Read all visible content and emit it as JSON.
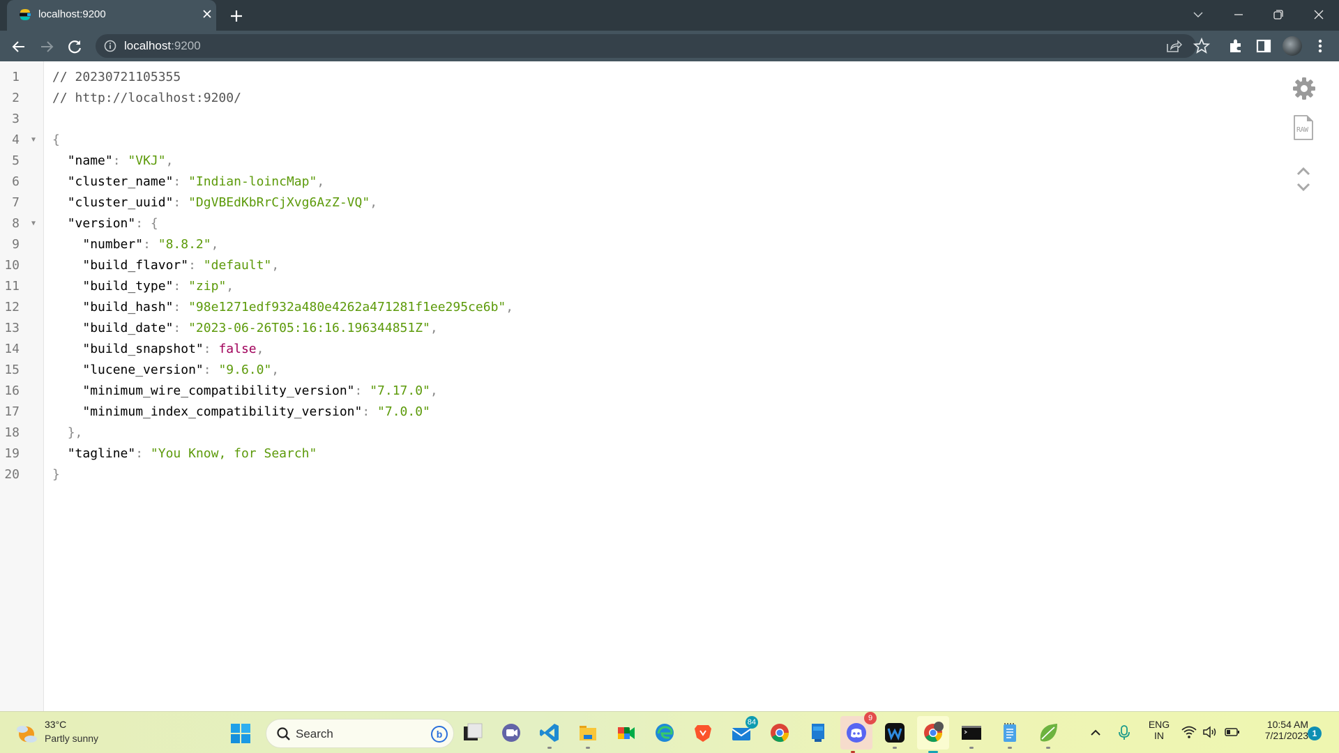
{
  "browser": {
    "tab": {
      "title": "localhost:9200",
      "favicon": "elasticsearch-logo-icon"
    },
    "new_tab_label": "+",
    "address_bar": {
      "host": "localhost",
      "port": ":9200"
    },
    "toolbar_icons": [
      "back-icon",
      "forward-icon",
      "reload-icon",
      "info-icon",
      "share-icon",
      "bookmark-star-icon",
      "extensions-puzzle-icon",
      "side-panel-icon",
      "profile-avatar",
      "menu-kebab-icon"
    ],
    "window_controls": [
      "tab-search-chevron-icon",
      "minimize-icon",
      "restore-icon",
      "close-icon"
    ]
  },
  "viewer": {
    "lines": [
      {
        "n": "1",
        "fold": false,
        "tokens": [
          {
            "t": "comment",
            "v": "// 20230721105355"
          }
        ]
      },
      {
        "n": "2",
        "fold": false,
        "tokens": [
          {
            "t": "comment",
            "v": "// http://localhost:9200/"
          }
        ]
      },
      {
        "n": "3",
        "fold": false,
        "tokens": []
      },
      {
        "n": "4",
        "fold": true,
        "tokens": [
          {
            "t": "punct",
            "v": "{"
          }
        ]
      },
      {
        "n": "5",
        "fold": false,
        "tokens": [
          {
            "t": "indent",
            "v": "  "
          },
          {
            "t": "key",
            "v": "\"name\""
          },
          {
            "t": "punct",
            "v": ": "
          },
          {
            "t": "str",
            "v": "\"VKJ\""
          },
          {
            "t": "punct",
            "v": ","
          }
        ]
      },
      {
        "n": "6",
        "fold": false,
        "tokens": [
          {
            "t": "indent",
            "v": "  "
          },
          {
            "t": "key",
            "v": "\"cluster_name\""
          },
          {
            "t": "punct",
            "v": ": "
          },
          {
            "t": "str",
            "v": "\"Indian-loincMap\""
          },
          {
            "t": "punct",
            "v": ","
          }
        ]
      },
      {
        "n": "7",
        "fold": false,
        "tokens": [
          {
            "t": "indent",
            "v": "  "
          },
          {
            "t": "key",
            "v": "\"cluster_uuid\""
          },
          {
            "t": "punct",
            "v": ": "
          },
          {
            "t": "str",
            "v": "\"DgVBEdKbRrCjXvg6AzZ-VQ\""
          },
          {
            "t": "punct",
            "v": ","
          }
        ]
      },
      {
        "n": "8",
        "fold": true,
        "tokens": [
          {
            "t": "indent",
            "v": "  "
          },
          {
            "t": "key",
            "v": "\"version\""
          },
          {
            "t": "punct",
            "v": ": {"
          }
        ]
      },
      {
        "n": "9",
        "fold": false,
        "tokens": [
          {
            "t": "indent",
            "v": "    "
          },
          {
            "t": "key",
            "v": "\"number\""
          },
          {
            "t": "punct",
            "v": ": "
          },
          {
            "t": "str",
            "v": "\"8.8.2\""
          },
          {
            "t": "punct",
            "v": ","
          }
        ]
      },
      {
        "n": "10",
        "fold": false,
        "tokens": [
          {
            "t": "indent",
            "v": "    "
          },
          {
            "t": "key",
            "v": "\"build_flavor\""
          },
          {
            "t": "punct",
            "v": ": "
          },
          {
            "t": "str",
            "v": "\"default\""
          },
          {
            "t": "punct",
            "v": ","
          }
        ]
      },
      {
        "n": "11",
        "fold": false,
        "tokens": [
          {
            "t": "indent",
            "v": "    "
          },
          {
            "t": "key",
            "v": "\"build_type\""
          },
          {
            "t": "punct",
            "v": ": "
          },
          {
            "t": "str",
            "v": "\"zip\""
          },
          {
            "t": "punct",
            "v": ","
          }
        ]
      },
      {
        "n": "12",
        "fold": false,
        "tokens": [
          {
            "t": "indent",
            "v": "    "
          },
          {
            "t": "key",
            "v": "\"build_hash\""
          },
          {
            "t": "punct",
            "v": ": "
          },
          {
            "t": "str",
            "v": "\"98e1271edf932a480e4262a471281f1ee295ce6b\""
          },
          {
            "t": "punct",
            "v": ","
          }
        ]
      },
      {
        "n": "13",
        "fold": false,
        "tokens": [
          {
            "t": "indent",
            "v": "    "
          },
          {
            "t": "key",
            "v": "\"build_date\""
          },
          {
            "t": "punct",
            "v": ": "
          },
          {
            "t": "str",
            "v": "\"2023-06-26T05:16:16.196344851Z\""
          },
          {
            "t": "punct",
            "v": ","
          }
        ]
      },
      {
        "n": "14",
        "fold": false,
        "tokens": [
          {
            "t": "indent",
            "v": "    "
          },
          {
            "t": "key",
            "v": "\"build_snapshot\""
          },
          {
            "t": "punct",
            "v": ": "
          },
          {
            "t": "bool",
            "v": "false"
          },
          {
            "t": "punct",
            "v": ","
          }
        ]
      },
      {
        "n": "15",
        "fold": false,
        "tokens": [
          {
            "t": "indent",
            "v": "    "
          },
          {
            "t": "key",
            "v": "\"lucene_version\""
          },
          {
            "t": "punct",
            "v": ": "
          },
          {
            "t": "str",
            "v": "\"9.6.0\""
          },
          {
            "t": "punct",
            "v": ","
          }
        ]
      },
      {
        "n": "16",
        "fold": false,
        "tokens": [
          {
            "t": "indent",
            "v": "    "
          },
          {
            "t": "key",
            "v": "\"minimum_wire_compatibility_version\""
          },
          {
            "t": "punct",
            "v": ": "
          },
          {
            "t": "str",
            "v": "\"7.17.0\""
          },
          {
            "t": "punct",
            "v": ","
          }
        ]
      },
      {
        "n": "17",
        "fold": false,
        "tokens": [
          {
            "t": "indent",
            "v": "    "
          },
          {
            "t": "key",
            "v": "\"minimum_index_compatibility_version\""
          },
          {
            "t": "punct",
            "v": ": "
          },
          {
            "t": "str",
            "v": "\"7.0.0\""
          }
        ]
      },
      {
        "n": "18",
        "fold": false,
        "tokens": [
          {
            "t": "indent",
            "v": "  "
          },
          {
            "t": "punct",
            "v": "},"
          }
        ]
      },
      {
        "n": "19",
        "fold": false,
        "tokens": [
          {
            "t": "indent",
            "v": "  "
          },
          {
            "t": "key",
            "v": "\"tagline\""
          },
          {
            "t": "punct",
            "v": ": "
          },
          {
            "t": "str",
            "v": "\"You Know, for Search\""
          }
        ]
      },
      {
        "n": "20",
        "fold": false,
        "tokens": [
          {
            "t": "punct",
            "v": "}"
          }
        ]
      }
    ],
    "side_tools": {
      "settings": "gear-icon",
      "raw_label": "RAW",
      "scroll_up": "chevron-up-icon",
      "scroll_down": "chevron-down-icon"
    }
  },
  "taskbar": {
    "weather": {
      "temp": "33°C",
      "desc": "Partly sunny"
    },
    "search_label": "Search",
    "bing_label": "b",
    "apps": [
      {
        "name": "task-view",
        "badge": null
      },
      {
        "name": "teams-meet",
        "badge": null
      },
      {
        "name": "vscode",
        "badge": null
      },
      {
        "name": "file-explorer",
        "badge": null
      },
      {
        "name": "google-meet",
        "badge": null
      },
      {
        "name": "edge",
        "badge": null
      },
      {
        "name": "brave",
        "badge": null
      },
      {
        "name": "mail",
        "badge": "84"
      },
      {
        "name": "chrome",
        "badge": null
      },
      {
        "name": "device-manager",
        "badge": null
      },
      {
        "name": "discord",
        "badge": "9"
      },
      {
        "name": "webex",
        "badge": null
      },
      {
        "name": "chrome-profile",
        "badge": null
      },
      {
        "name": "terminal",
        "badge": null
      },
      {
        "name": "notepad",
        "badge": null
      },
      {
        "name": "spring-tools",
        "badge": null
      }
    ],
    "tray": {
      "lang_top": "ENG",
      "lang_bottom": "IN",
      "time": "10:54 AM",
      "date": "7/21/2023",
      "notification_count": "1"
    }
  },
  "colors": {
    "string": "#5c9a0a",
    "boolean": "#a0005a",
    "chrome_dark": "#2e3940",
    "chrome_toolbar": "#44545e"
  }
}
